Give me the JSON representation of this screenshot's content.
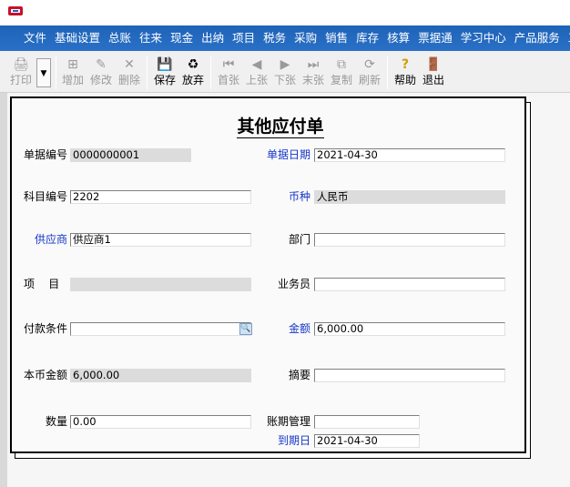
{
  "menu": [
    "文件",
    "基础设置",
    "总账",
    "往来",
    "现金",
    "出纳",
    "项目",
    "税务",
    "采购",
    "销售",
    "库存",
    "核算",
    "票据通",
    "学习中心",
    "产品服务",
    "工作"
  ],
  "toolbar": {
    "print": "打印",
    "add": "增加",
    "edit": "修改",
    "delete": "删除",
    "save": "保存",
    "discard": "放弃",
    "first": "首张",
    "prev": "上张",
    "next": "下张",
    "last": "末张",
    "copy": "复制",
    "refresh": "刷新",
    "help": "帮助",
    "exit": "退出"
  },
  "form": {
    "title": "其他应付单",
    "doc_no": {
      "label": "单据编号",
      "value": "0000000001"
    },
    "doc_date": {
      "label": "单据日期",
      "value": "2021-04-30"
    },
    "account": {
      "label": "科目编号",
      "value": "2202"
    },
    "currency": {
      "label": "币种",
      "value": "人民币"
    },
    "supplier": {
      "label": "供应商",
      "value": "供应商1"
    },
    "dept": {
      "label": "部门",
      "value": ""
    },
    "project": {
      "label": "项    目",
      "value": ""
    },
    "salesman": {
      "label": "业务员",
      "value": ""
    },
    "pay_terms": {
      "label": "付款条件",
      "value": ""
    },
    "amount": {
      "label": "金额",
      "value": "6,000.00"
    },
    "local_amount": {
      "label": "本币金额",
      "value": "6,000.00"
    },
    "summary": {
      "label": "摘要",
      "value": ""
    },
    "quantity": {
      "label": "数量",
      "value": "0.00"
    },
    "period_mgmt": {
      "label": "账期管理",
      "value": ""
    },
    "due_date": {
      "label": "到期日",
      "value": "2021-04-30"
    }
  }
}
